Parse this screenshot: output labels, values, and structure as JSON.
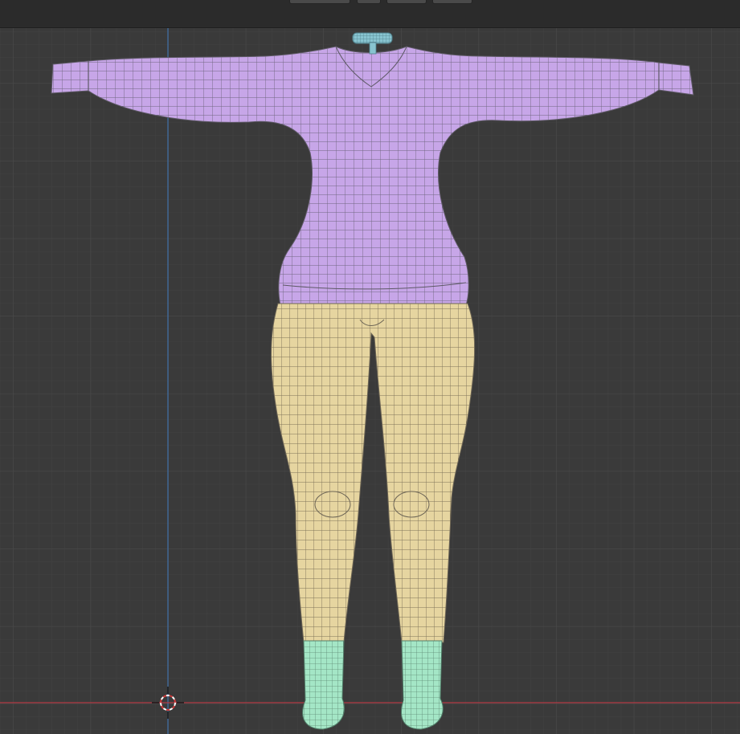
{
  "viewport": {
    "background": "#3a3a3a",
    "grid_minor_color": "#424242",
    "grid_major_color": "#4b4b4b",
    "axis_x_color": "#b33a44",
    "axis_z_color": "#3f6fa8"
  },
  "model": {
    "sweater_color": "#c7a6e8",
    "pants_color": "#e6d5a0",
    "socks_color": "#a4e6c6",
    "collar_color": "#88c4d0",
    "wire_color": "#5e5a55"
  },
  "header": {
    "widgets": [
      "mode-dropdown",
      "overlay-toggle",
      "shading-toggle-1",
      "shading-toggle-2"
    ]
  },
  "icons": [
    "3d-cursor-icon"
  ]
}
